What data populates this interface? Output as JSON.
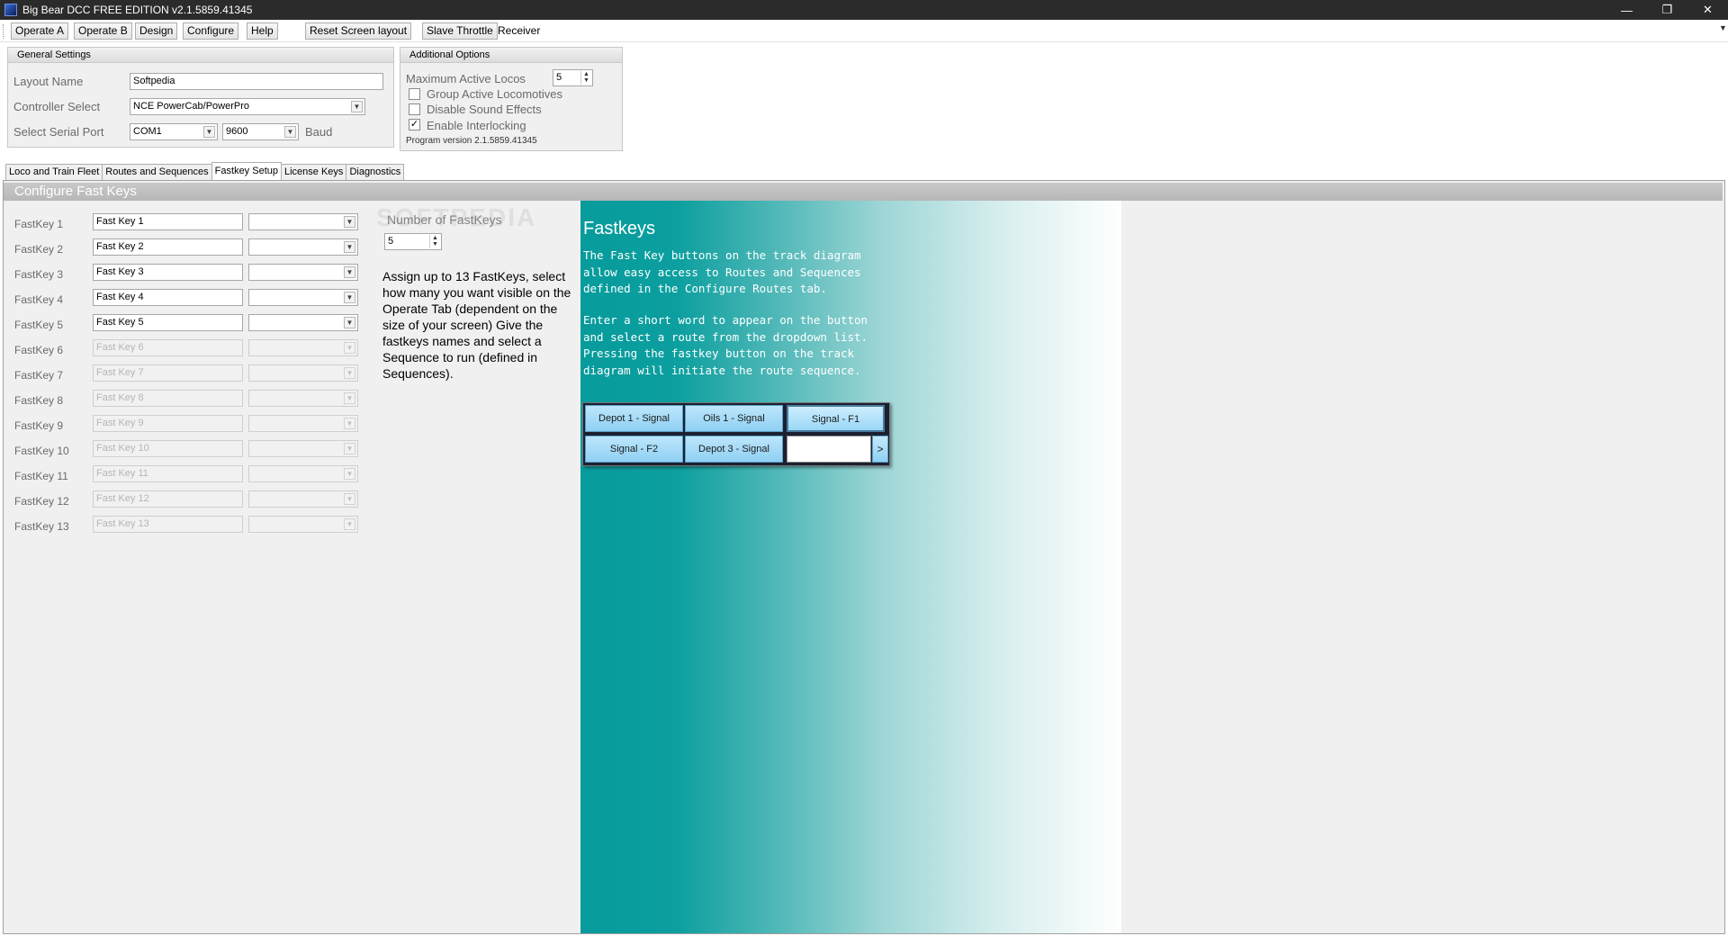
{
  "window": {
    "title": "Big Bear DCC FREE EDITION  v2.1.5859.41345",
    "minimize": "—",
    "restore": "❐",
    "close": "✕"
  },
  "toolbar": {
    "operate_a": "Operate A",
    "operate_b": "Operate B",
    "design": "Design",
    "configure": "Configure",
    "help": "Help",
    "reset_layout": "Reset Screen layout",
    "slave_throttle": "Slave Throttle",
    "receiver": "Receiver"
  },
  "general_settings": {
    "header": "General Settings",
    "layout_name_label": "Layout Name",
    "layout_name_value": "Softpedia",
    "controller_label": "Controller Select",
    "controller_value": "NCE PowerCab/PowerPro",
    "serial_port_label": "Select Serial Port",
    "serial_port_value": "COM1",
    "baud_value": "9600",
    "baud_label": "Baud"
  },
  "additional_options": {
    "header": "Additional Options",
    "max_locos_label": "Maximum Active Locos",
    "max_locos_value": "5",
    "group_active_label": "Group Active Locomotives",
    "group_active_checked": false,
    "disable_sound_label": "Disable Sound Effects",
    "disable_sound_checked": false,
    "interlocking_label": "Enable Interlocking",
    "interlocking_checked": true,
    "program_version": "Program version 2.1.5859.41345"
  },
  "tabs": [
    {
      "label": "Loco and Train Fleet"
    },
    {
      "label": "Routes and Sequences"
    },
    {
      "label": "Fastkey Setup",
      "active": true
    },
    {
      "label": "License Keys"
    },
    {
      "label": "Diagnostics"
    }
  ],
  "fastkey_panel": {
    "header": "Configure Fast Keys",
    "number_label": "Number of FastKeys",
    "number_value": "5",
    "watermark": "SOFTPEDIA",
    "instructions": "Assign up to 13 FastKeys, select how many you want visible on the Operate Tab (dependent on the size of your screen) Give the fastkeys names and select a Sequence to run (defined in Sequences).",
    "keys": [
      {
        "label": "FastKey 1",
        "name": "Fast Key 1",
        "enabled": true
      },
      {
        "label": "FastKey 2",
        "name": "Fast Key 2",
        "enabled": true
      },
      {
        "label": "FastKey 3",
        "name": "Fast Key 3",
        "enabled": true
      },
      {
        "label": "FastKey 4",
        "name": "Fast Key 4",
        "enabled": true
      },
      {
        "label": "FastKey 5",
        "name": "Fast Key 5",
        "enabled": true
      },
      {
        "label": "FastKey 6",
        "name": "Fast Key 6",
        "enabled": false
      },
      {
        "label": "FastKey 7",
        "name": "Fast Key 7",
        "enabled": false
      },
      {
        "label": "FastKey 8",
        "name": "Fast Key 8",
        "enabled": false
      },
      {
        "label": "FastKey 9",
        "name": "Fast Key 9",
        "enabled": false
      },
      {
        "label": "FastKey 10",
        "name": "Fast Key 10",
        "enabled": false
      },
      {
        "label": "FastKey 11",
        "name": "Fast Key 11",
        "enabled": false
      },
      {
        "label": "FastKey 12",
        "name": "Fast Key 12",
        "enabled": false
      },
      {
        "label": "FastKey 13",
        "name": "Fast Key 13",
        "enabled": false
      }
    ]
  },
  "help_panel": {
    "title": "Fastkeys",
    "paragraph1": "The Fast Key buttons on the track diagram allow easy access to Routes and Sequences defined in the Configure Routes tab.",
    "paragraph2": "Enter a short word to appear on the button and select a route from the dropdown list. Pressing the fastkey button on the track diagram will initiate the route sequence.",
    "demo_buttons": [
      "Depot 1 - Signal",
      "Oils 1 - Signal",
      "Signal - F1",
      "Signal - F2",
      "Depot 3 - Signal"
    ],
    "demo_go": ">"
  },
  "colors": {
    "help_gradient_start": "#079b9b",
    "demo_button": "#8fd0f4",
    "titlebar": "#2b2b2b"
  }
}
